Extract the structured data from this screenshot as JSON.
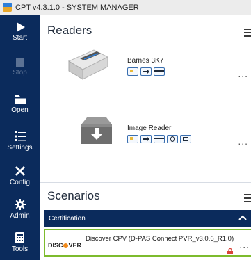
{
  "window": {
    "title": "CPT v4.3.1.0 - SYSTEM MANAGER"
  },
  "sidebar": {
    "items": [
      {
        "label": "Start",
        "icon": "play-icon",
        "enabled": true
      },
      {
        "label": "Stop",
        "icon": "stop-icon",
        "enabled": false
      },
      {
        "label": "Open",
        "icon": "folder-icon",
        "enabled": true
      },
      {
        "label": "Settings",
        "icon": "settings-list-icon",
        "enabled": true
      },
      {
        "label": "Config",
        "icon": "tools-icon",
        "enabled": true
      },
      {
        "label": "Admin",
        "icon": "gear-icon",
        "enabled": true
      },
      {
        "label": "Tools",
        "icon": "calculator-icon",
        "enabled": true
      }
    ]
  },
  "readers": {
    "title": "Readers",
    "items": [
      {
        "name": "Barnes 3K7",
        "icon": "card-reader-device-icon",
        "capabilities": [
          "contact-chip-icon",
          "insert-card-icon",
          "magstripe-icon"
        ],
        "more": "..."
      },
      {
        "name": "Image Reader",
        "icon": "download-box-icon",
        "capabilities": [
          "contact-chip-icon",
          "insert-card-icon",
          "magstripe-icon",
          "contactless-icon",
          "image-card-icon"
        ],
        "more": "..."
      }
    ]
  },
  "scenarios": {
    "title": "Scenarios",
    "group": {
      "label": "Certification",
      "expanded": true
    },
    "items": [
      {
        "brand": "DISCOVER",
        "name": "Discover CPV (D-PAS Connect PVR_v3.0.6_R1.0)",
        "locked": true,
        "more": "..."
      }
    ]
  },
  "colors": {
    "sidebar": "#0b2b5c",
    "accent_green": "#7dbb2d",
    "discover_orange": "#f08a1c"
  }
}
